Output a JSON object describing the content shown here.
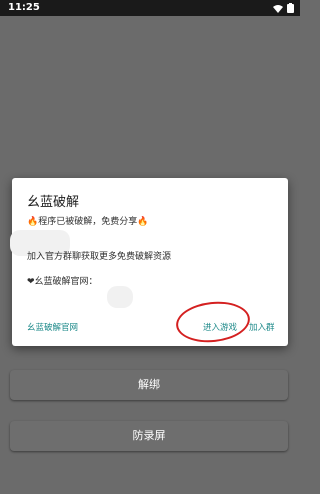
{
  "status_bar": {
    "time": "11:25",
    "wifi_icon": "wifi-icon",
    "battery_icon": "battery-icon"
  },
  "background_buttons": {
    "unbind_label": "解绑",
    "anti_record_label": "防录屏"
  },
  "dialog": {
    "title": "幺蓝破解",
    "line1": "🔥程序已被破解，免费分享🔥",
    "line2": "加入官方群聊获取更多免费破解资源",
    "line3": "❤幺蓝破解官网：",
    "actions": {
      "website_label": "幺蓝破解官网",
      "enter_game_label": "进入游戏",
      "join_group_label": "加入群"
    }
  },
  "colors": {
    "link": "#1e8a8a",
    "highlight_circle": "#d42020",
    "overlay": "#6b6b6b"
  }
}
